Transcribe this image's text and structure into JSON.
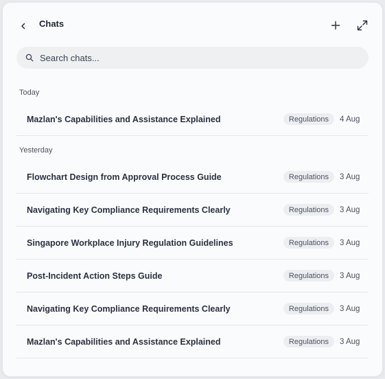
{
  "header": {
    "title": "Chats",
    "back_icon": "chevron-left-icon",
    "new_icon": "plus-icon",
    "expand_icon": "expand-icon"
  },
  "search": {
    "placeholder": "Search chats...",
    "value": ""
  },
  "groups": [
    {
      "label": "Today",
      "items": [
        {
          "title": "Mazlan's Capabilities and Assistance Explained",
          "tag": "Regulations",
          "date": "4 Aug"
        }
      ]
    },
    {
      "label": "Yesterday",
      "items": [
        {
          "title": "Flowchart Design from Approval Process Guide",
          "tag": "Regulations",
          "date": "3 Aug"
        },
        {
          "title": "Navigating Key Compliance Requirements Clearly",
          "tag": "Regulations",
          "date": "3 Aug"
        },
        {
          "title": "Singapore Workplace Injury Regulation Guidelines",
          "tag": "Regulations",
          "date": "3 Aug"
        },
        {
          "title": "Post-Incident Action Steps Guide",
          "tag": "Regulations",
          "date": "3 Aug"
        },
        {
          "title": "Navigating Key Compliance Requirements Clearly",
          "tag": "Regulations",
          "date": "3 Aug"
        },
        {
          "title": "Mazlan's Capabilities and Assistance Explained",
          "tag": "Regulations",
          "date": "3 Aug"
        }
      ]
    }
  ],
  "colors": {
    "panel_bg": "#fafbfc",
    "title_text": "#1f2633",
    "tag_bg": "#eceef1",
    "divider": "#e3e6ea"
  }
}
